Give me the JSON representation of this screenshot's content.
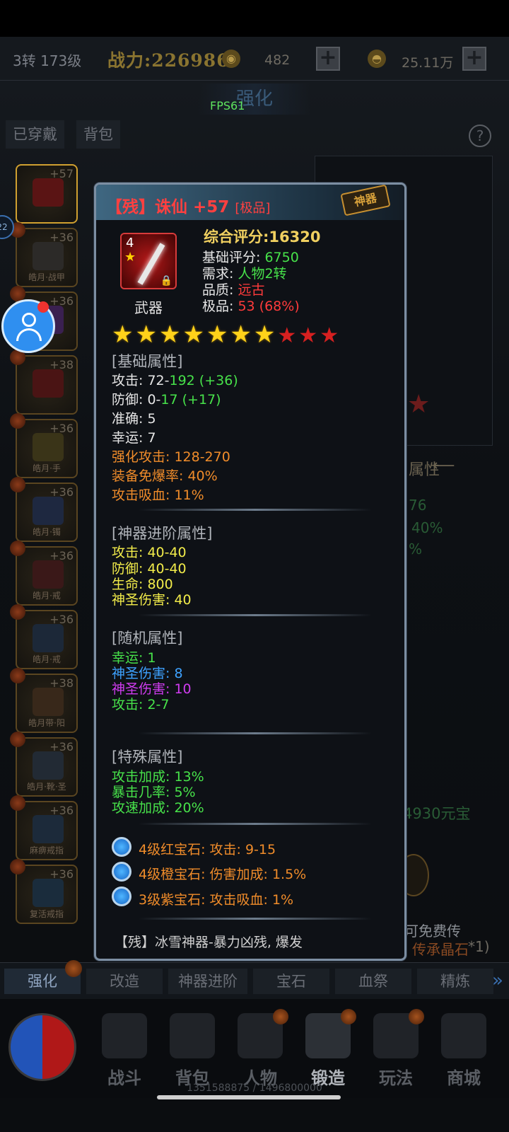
{
  "topbar": {
    "level": "3转 173级",
    "power": "战力:226986",
    "currency1": "482",
    "currency2": "25.11万"
  },
  "section_title": "强化",
  "fps": "FPS61",
  "tabs": {
    "equipped": "已穿戴",
    "bag": "背包",
    "help": "?"
  },
  "badge": "22",
  "side_items": [
    {
      "level": "+57",
      "name": ""
    },
    {
      "level": "+36",
      "name": "皓月·战甲"
    },
    {
      "level": "+36",
      "name": ""
    },
    {
      "level": "+38",
      "name": ""
    },
    {
      "level": "+36",
      "name": "皓月·手"
    },
    {
      "level": "+36",
      "name": "皓月·镯"
    },
    {
      "level": "+36",
      "name": "皓月·戒"
    },
    {
      "level": "+36",
      "name": "皓月·戒"
    },
    {
      "level": "+38",
      "name": "皓月带·阳"
    },
    {
      "level": "+36",
      "name": "皓月·靴·圣"
    },
    {
      "level": "+36",
      "name": "麻痹戒指"
    },
    {
      "level": "+36",
      "name": "复活戒指"
    }
  ],
  "behind": {
    "attr_heading": "属性",
    "v1": "76",
    "v2": "40%",
    "v3": "%",
    "price": "4930元宝",
    "free_text": "可免费传",
    "crystal": "传承晶石",
    "crystal_count": "*1)"
  },
  "tooltip": {
    "prefix": "【残】",
    "name": "诛仙 +57",
    "quality_tag": "[极品]",
    "stamp": "神器",
    "icon_level": "4",
    "item_type": "武器",
    "rating_label": "综合评分:",
    "rating_value": "16320",
    "base_label": "基础评分: ",
    "base_value": "6750",
    "req_label": "需求: ",
    "req_value": "人物2转",
    "quality_label": "品质: ",
    "quality_value": "远古",
    "extreme_label": "极品: ",
    "extreme_value": "53 (68%)",
    "stars_filled": 7,
    "stars_total": 10,
    "basic_title": "[基础属性]",
    "basic": {
      "atk_label": "攻击: ",
      "atk_min": "72-",
      "atk_max": "192 (+36)",
      "def_label": "防御: ",
      "def_min": "0-",
      "def_max": "17 (+17)",
      "acc": "准确: 5",
      "luck": "幸运: 7",
      "enh_atk": "强化攻击: 128-270",
      "crit_res": "装备免爆率: 40%",
      "lifesteal": "攻击吸血: 11%"
    },
    "adv_title": "[神器进阶属性]",
    "adv": [
      "攻击: 40-40",
      "防御: 40-40",
      "生命: 800",
      "神圣伤害: 40"
    ],
    "random_title": "[随机属性]",
    "random": {
      "luck_label": "幸运: ",
      "luck_value": "1",
      "holy1_label": "神圣伤害: ",
      "holy1_value": "8",
      "holy2_label": "神圣伤害: ",
      "holy2_value": "10",
      "atk_label": "攻击: ",
      "atk_value": "2-7"
    },
    "special_title": "[特殊属性]",
    "special": [
      "攻击加成: 13%",
      "暴击几率: 5%",
      "攻速加成: 20%"
    ],
    "gems": [
      "4级红宝石: 攻击: 9-15",
      "4级橙宝石: 伤害加成: 1.5%",
      "3级紫宝石: 攻击吸血: 1%"
    ],
    "desc": "【残】冰雪神器-暴力凶残, 爆发"
  },
  "func_tabs": [
    "强化",
    "改造",
    "神器进阶",
    "宝石",
    "血祭",
    "精炼"
  ],
  "nav": [
    "战斗",
    "背包",
    "人物",
    "锻造",
    "玩法",
    "商城"
  ],
  "exp": "1351588875 / 1496800000",
  "colors": {
    "accent_red": "#ff3b3b",
    "green": "#47e24a",
    "orange": "#f08c2a",
    "yellow": "#f2ec4a",
    "gold": "#f0d060"
  }
}
